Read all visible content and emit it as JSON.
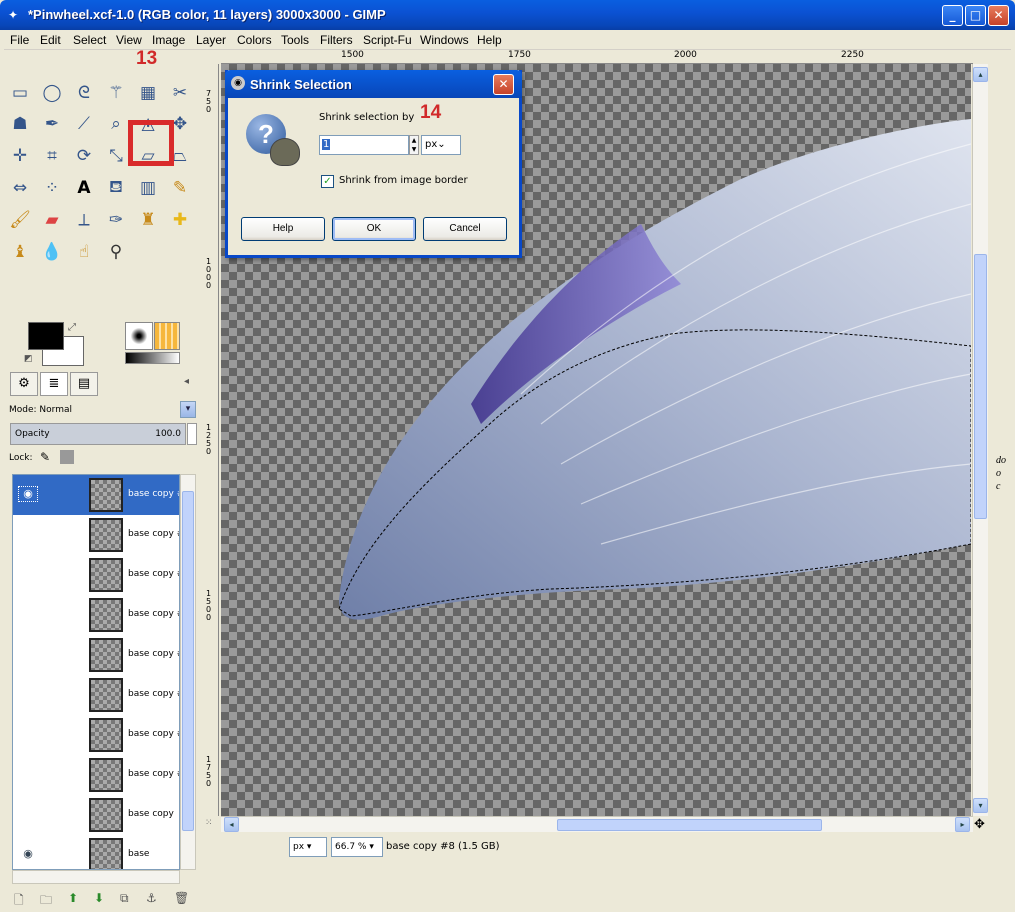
{
  "window": {
    "title": "*Pinwheel.xcf-1.0 (RGB color, 11 layers) 3000x3000 - GIMP",
    "minimize": "_",
    "maximize": "□",
    "close": "✕"
  },
  "menu": [
    "File",
    "Edit",
    "Select",
    "View",
    "Image",
    "Layer",
    "Colors",
    "Tools",
    "Filters",
    "Script-Fu",
    "Windows",
    "Help"
  ],
  "annotations": {
    "step13": "13",
    "step14": "14"
  },
  "layers_panel": {
    "mode_label": "Mode: Normal",
    "opacity_label": "Opacity",
    "opacity_value": "100.0",
    "lock_label": "Lock:",
    "layers": [
      {
        "name": "base copy #",
        "visible": true,
        "selected": true
      },
      {
        "name": "base copy #",
        "visible": false,
        "selected": false
      },
      {
        "name": "base copy #",
        "visible": false,
        "selected": false
      },
      {
        "name": "base copy #",
        "visible": false,
        "selected": false
      },
      {
        "name": "base copy #",
        "visible": false,
        "selected": false
      },
      {
        "name": "base copy #",
        "visible": false,
        "selected": false
      },
      {
        "name": "base copy #",
        "visible": false,
        "selected": false
      },
      {
        "name": "base copy #",
        "visible": false,
        "selected": false
      },
      {
        "name": "base copy",
        "visible": false,
        "selected": false
      },
      {
        "name": "base",
        "visible": true,
        "selected": false
      }
    ]
  },
  "rulers": {
    "h": [
      "1500",
      "1750",
      "2000",
      "2250"
    ],
    "v": [
      "750",
      "1000",
      "1250",
      "1500",
      "1750"
    ]
  },
  "status": {
    "unit": "px",
    "zoom": "66.7 %",
    "text": "base copy #8 (1.5 GB)"
  },
  "side_text": [
    "do",
    "o",
    "c"
  ],
  "dialog": {
    "title": "Shrink Selection",
    "label": "Shrink selection by",
    "value": "1",
    "unit": "px",
    "checkbox_label": "Shrink from image border",
    "checkbox_checked": true,
    "buttons": {
      "help": "Help",
      "ok": "OK",
      "cancel": "Cancel"
    }
  }
}
